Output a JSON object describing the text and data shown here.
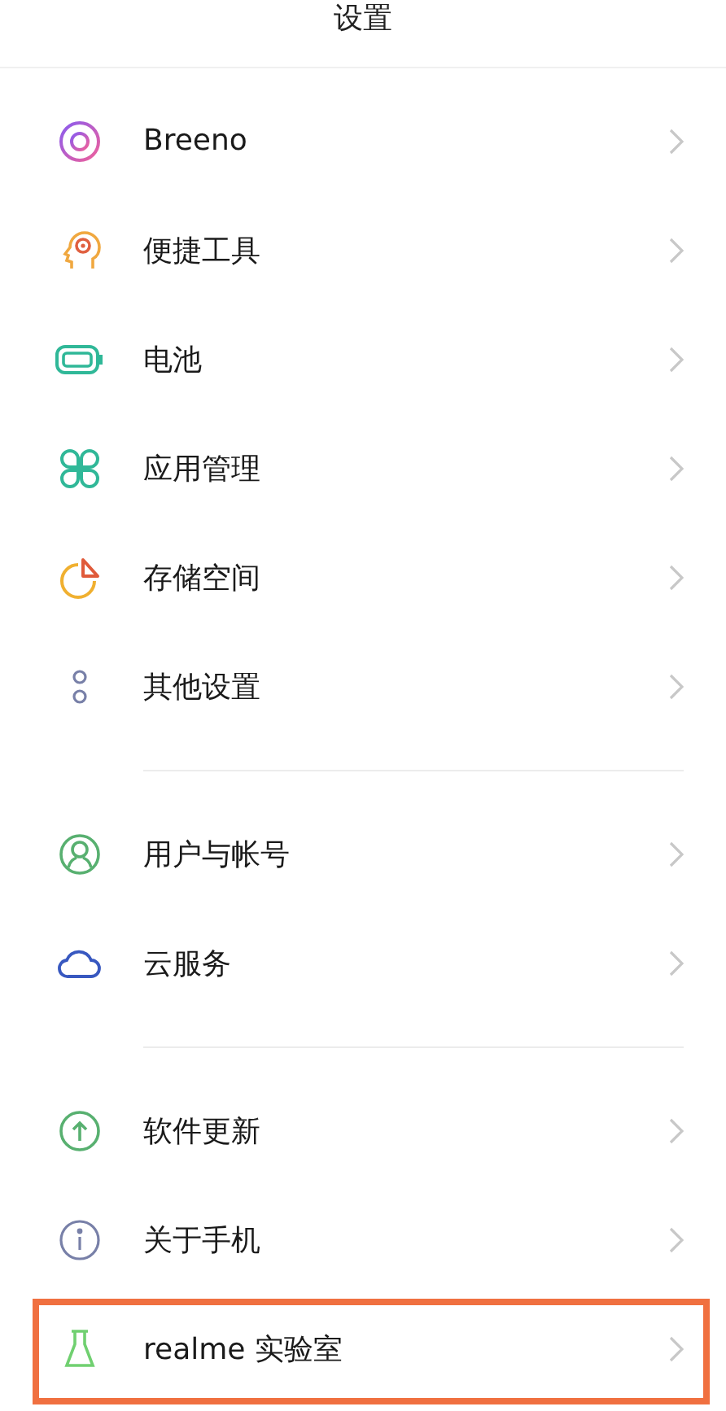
{
  "header": {
    "title": "设置"
  },
  "groups": [
    {
      "items": [
        {
          "label": "Breeno",
          "highlighted": false
        },
        {
          "label": "便捷工具",
          "highlighted": false
        },
        {
          "label": "电池",
          "highlighted": false
        },
        {
          "label": "应用管理",
          "highlighted": false
        },
        {
          "label": "存储空间",
          "highlighted": false
        },
        {
          "label": "其他设置",
          "highlighted": false
        }
      ]
    },
    {
      "items": [
        {
          "label": "用户与帐号",
          "highlighted": false
        },
        {
          "label": "云服务",
          "highlighted": false
        }
      ]
    },
    {
      "items": [
        {
          "label": "软件更新",
          "highlighted": false
        },
        {
          "label": "关于手机",
          "highlighted": false
        },
        {
          "label": "realme 实验室",
          "highlighted": true
        }
      ]
    }
  ]
}
